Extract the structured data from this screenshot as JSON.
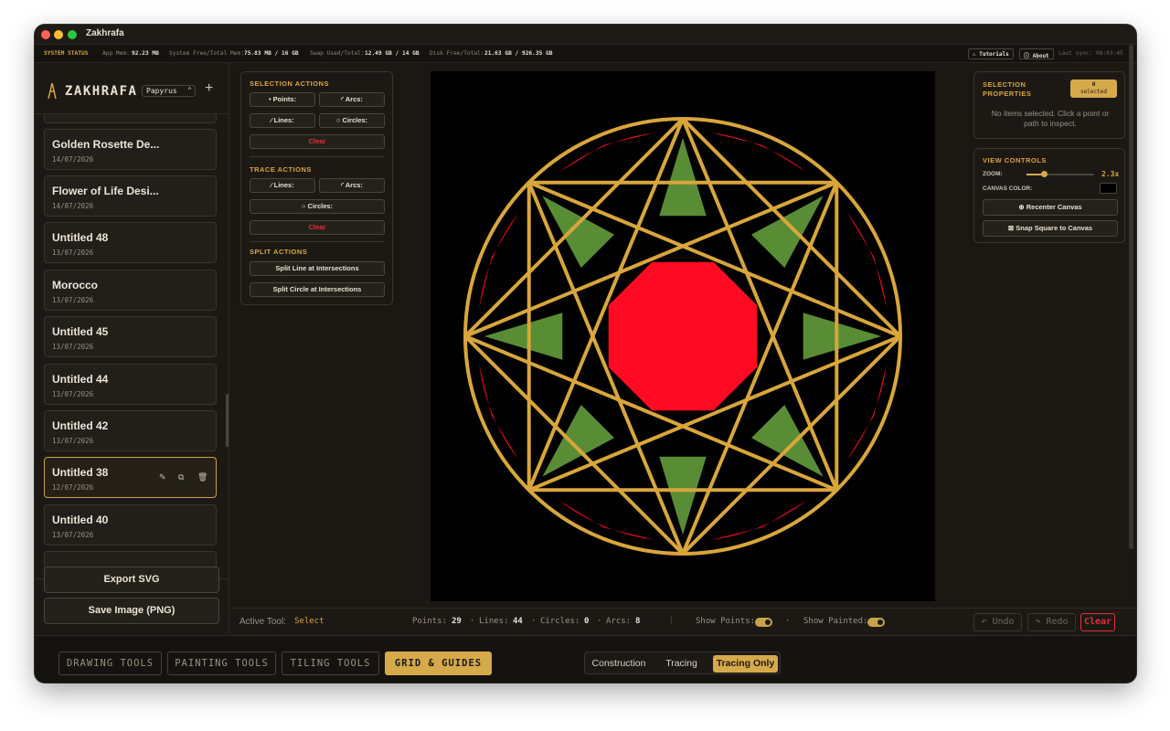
{
  "window": {
    "title": "Zakhrafa"
  },
  "status": {
    "label": "SYSTEM STATUS",
    "app_mem_label": "App Mem:",
    "app_mem": "92.23 MB",
    "sys_mem_label": "System Free/Total Mem:",
    "sys_mem": "75.83 MB / 16 GB",
    "swap_label": "Swap Used/Total:",
    "swap": "12.49 GB / 14 GB",
    "disk_label": "Disk Free/Total:",
    "disk": "21.63 GB / 926.35 GB",
    "tutorials": "⚠ Tutorials",
    "about": "ⓘ About",
    "last_sync": "Last sync: 08:03:45"
  },
  "sidebar": {
    "logo": "ZAKHRAFA",
    "font_select": "Papyrus",
    "add": "+",
    "projects": [
      {
        "name": "Golden Rosette De...",
        "date": "14/07/2026"
      },
      {
        "name": "Flower of Life Desi...",
        "date": "14/07/2026"
      },
      {
        "name": "Untitled 48",
        "date": "13/07/2026"
      },
      {
        "name": "Morocco",
        "date": "13/07/2026"
      },
      {
        "name": "Untitled 45",
        "date": "13/07/2026"
      },
      {
        "name": "Untitled 44",
        "date": "13/07/2026"
      },
      {
        "name": "Untitled 42",
        "date": "13/07/2026"
      },
      {
        "name": "Untitled 38",
        "date": "12/07/2026"
      },
      {
        "name": "Untitled 40",
        "date": "13/07/2026"
      }
    ],
    "export_svg": "Export SVG",
    "save_png": "Save Image (PNG)"
  },
  "actions": {
    "selection_title": "SELECTION ACTIONS",
    "points": "• Points:",
    "arcs": "◜ Arcs:",
    "lines": "⁄ Lines:",
    "circles": "○ Circles:",
    "clear": "Clear",
    "trace_title": "TRACE ACTIONS",
    "trace_lines": "⁄ Lines:",
    "trace_arcs": "◜ Arcs:",
    "trace_circles": "○ Circles:",
    "trace_clear": "Clear",
    "split_title": "SPLIT ACTIONS",
    "split_line": "Split Line at Intersections",
    "split_circle": "Split Circle at Intersections"
  },
  "selection_props": {
    "title_1": "SELECTION",
    "title_2": "PROPERTIES",
    "badge_count": "0",
    "badge_label": "selected",
    "empty_1": "No items selected. Click a point or",
    "empty_2": "path to inspect."
  },
  "view_controls": {
    "title": "VIEW CONTROLS",
    "zoom_label": "ZOOM:",
    "zoom_value": "2.3x",
    "zoom_level": 0.25,
    "canvas_color_label": "CANVAS COLOR:",
    "canvas_color": "#000000",
    "recenter": "⊕ Recenter Canvas",
    "snap": "⊠ Snap Square to Canvas"
  },
  "artwork": {
    "stroke": "#d9a63a",
    "red": "#ff0a22",
    "green": "#588d36"
  },
  "bottom": {
    "active_tool_label": "Active Tool:",
    "active_tool": "Select",
    "points_label": "Points:",
    "points": "29",
    "lines_label": "Lines:",
    "lines": "44",
    "circles_label": "Circles:",
    "circles": "0",
    "arcs_label": "Arcs:",
    "arcs": "8",
    "show_points": "Show Points:",
    "show_painted": "Show Painted:",
    "undo": "↶ Undo",
    "redo": "↷ Redo",
    "clear": "Clear"
  },
  "footer": {
    "tabs": [
      "DRAWING TOOLS",
      "PAINTING TOOLS",
      "TILING TOOLS",
      "GRID & GUIDES"
    ],
    "modes": [
      "Construction",
      "Tracing",
      "Tracing Only"
    ]
  }
}
